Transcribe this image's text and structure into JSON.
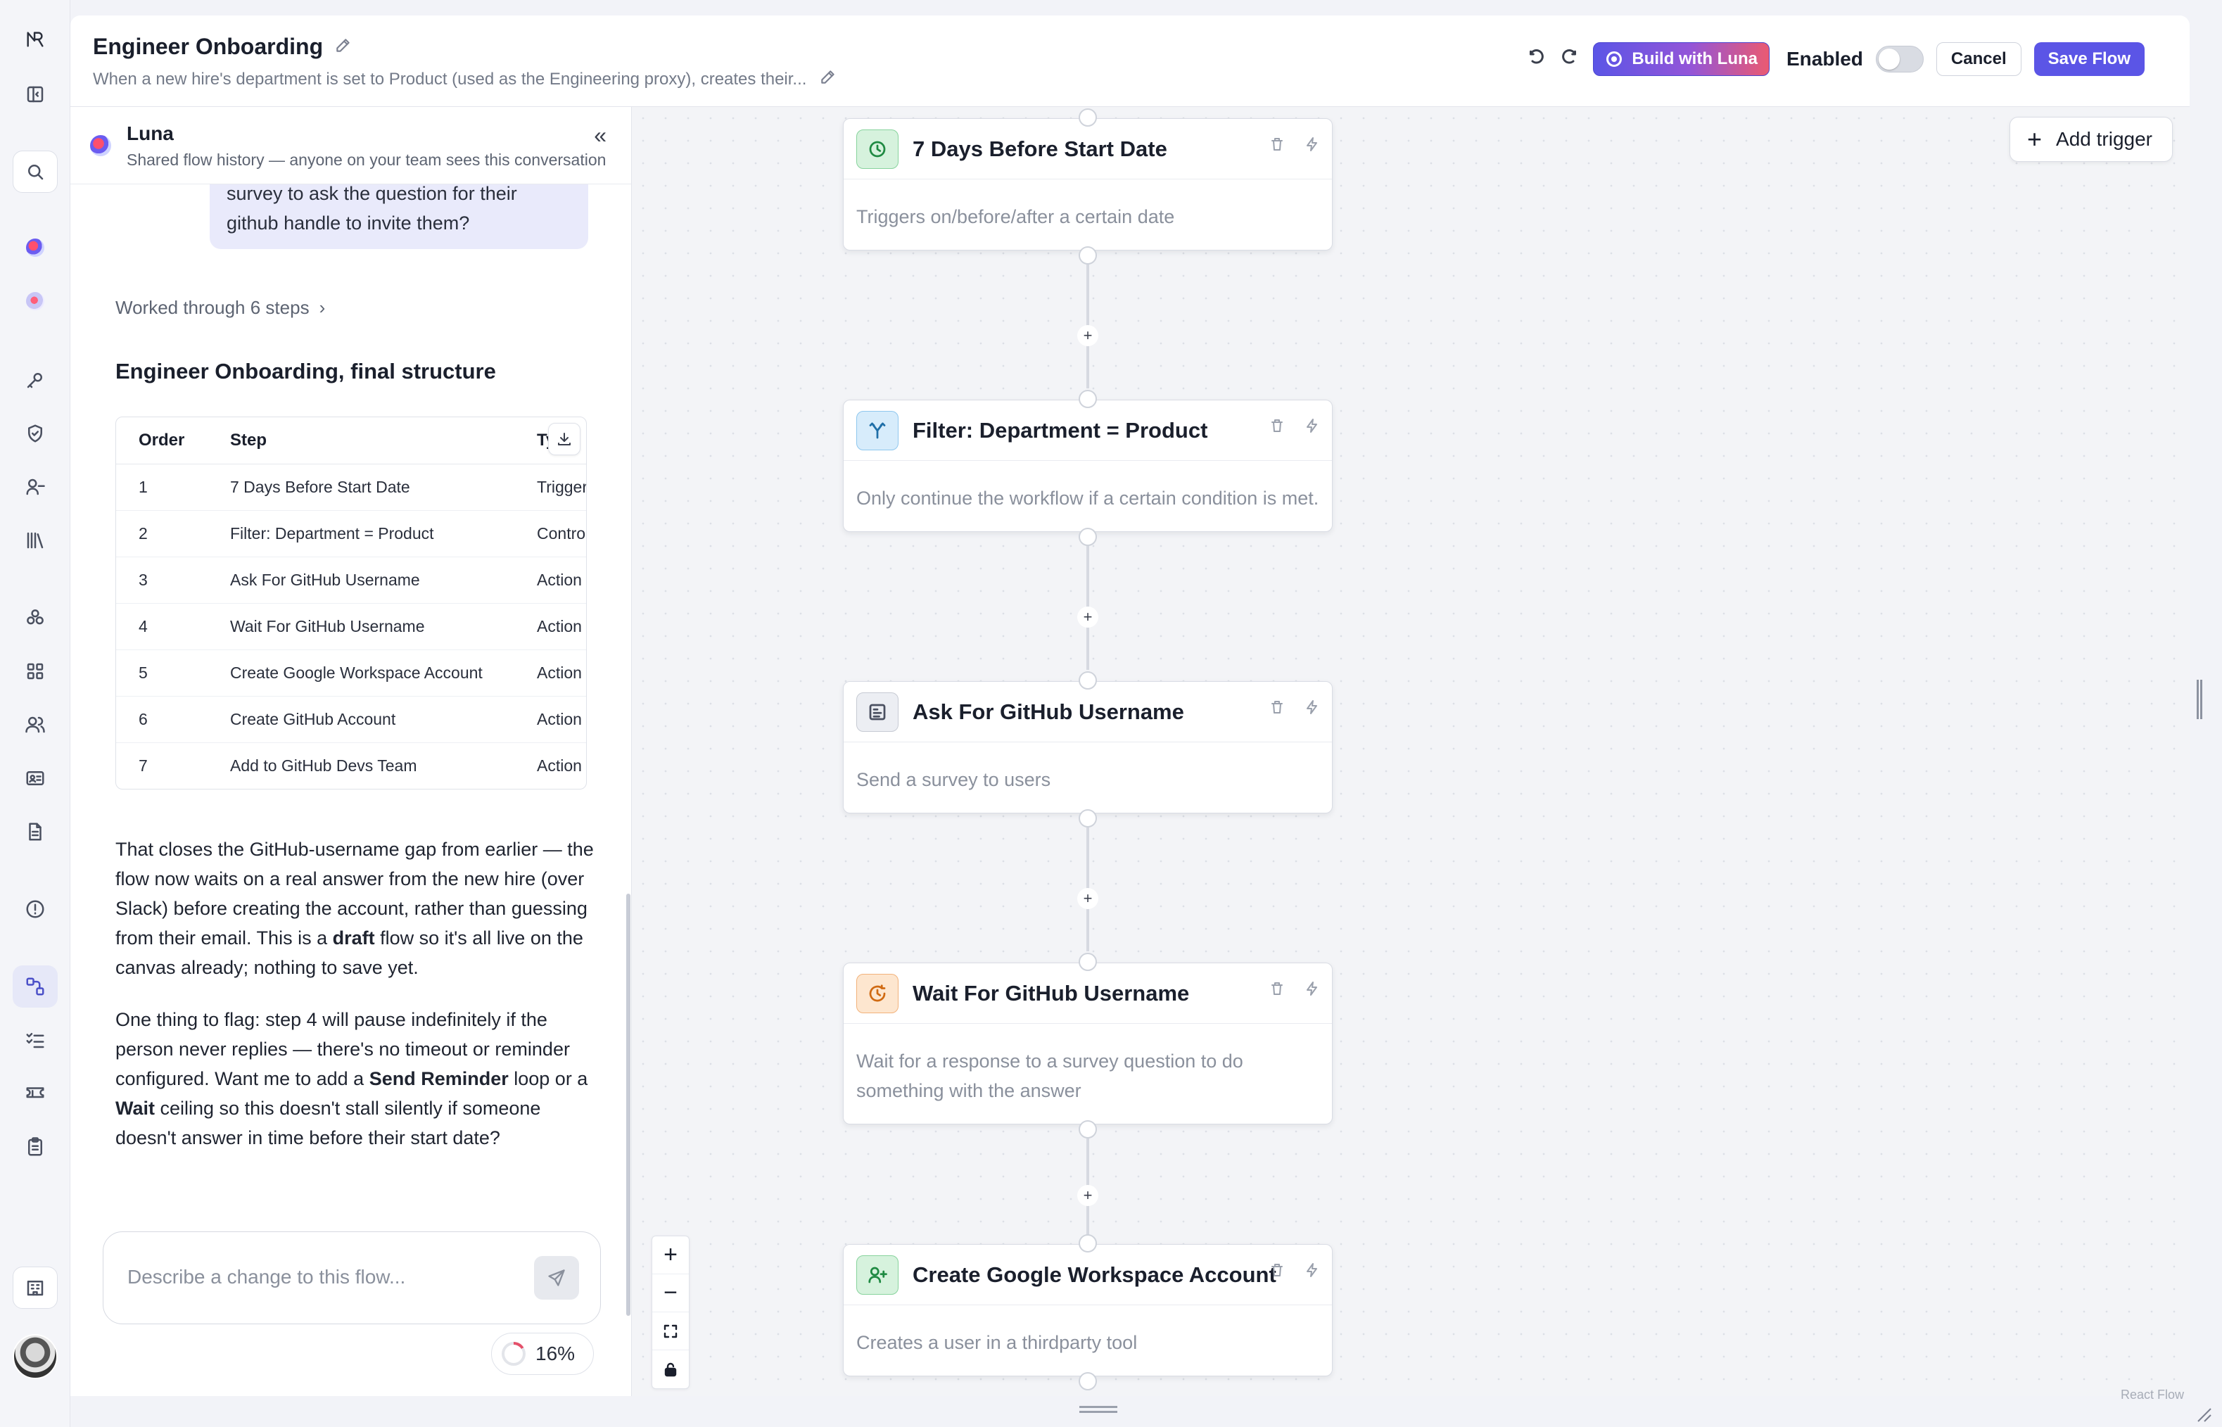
{
  "header": {
    "title": "Engineer Onboarding",
    "subtitle": "When a new hire's department is set to Product (used as the Engineering proxy), creates their...",
    "build_with_luna": "Build with Luna",
    "enabled_label": "Enabled",
    "enabled": false,
    "cancel": "Cancel",
    "save_flow": "Save Flow"
  },
  "sidebar": {
    "icons": [
      "logo-icon",
      "panel-toggle-icon",
      "search-icon",
      "luna-orb-icon",
      "luna-orb-light-icon",
      "key-icon",
      "shield-icon",
      "user-minus-icon",
      "library-icon",
      "integrations-icon",
      "apps-grid-icon",
      "users-icon",
      "id-card-icon",
      "document-icon",
      "alert-icon",
      "workflows-icon",
      "checklist-icon",
      "ticket-icon",
      "clipboard-icon",
      "building-icon"
    ]
  },
  "luna": {
    "name": "Luna",
    "description": "Shared flow history — anyone on your team sees this conversation",
    "user_message_lines": [
      "survey to ask the question for their",
      "github handle to invite them?"
    ],
    "worked_through": "Worked through 6 steps",
    "structure_title": "Engineer Onboarding, final structure",
    "table": {
      "headers": [
        "Order",
        "Step",
        "Type"
      ],
      "rows": [
        [
          "1",
          "7 Days Before Start Date",
          "Trigger"
        ],
        [
          "2",
          "Filter: Department = Product",
          "Control"
        ],
        [
          "3",
          "Ask For GitHub Username",
          "Action"
        ],
        [
          "4",
          "Wait For GitHub Username",
          "Action"
        ],
        [
          "5",
          "Create Google Workspace Account",
          "Action"
        ],
        [
          "6",
          "Create GitHub Account",
          "Action"
        ],
        [
          "7",
          "Add to GitHub Devs Team",
          "Action"
        ]
      ]
    },
    "para1": {
      "t1": "That closes the GitHub-username gap from earlier — the flow now waits on a real answer from the new hire (over Slack) before creating the account, rather than guessing from their email. This is a ",
      "b1": "draft",
      "t2": " flow so it's all live on the canvas already; nothing to save yet."
    },
    "para2": {
      "t1": "One thing to flag: step 4 will pause indefinitely if the person never replies — there's no timeout or reminder configured. Want me to add a ",
      "b1": "Send Reminder",
      "t2": " loop or a ",
      "b2": "Wait",
      "t3": " ceiling so this doesn't stall silently if someone doesn't answer in time before their start date?"
    },
    "composer_placeholder": "Describe a change to this flow...",
    "usage_percent": "16%",
    "usage_fraction": 0.16
  },
  "canvas": {
    "add_trigger": "Add trigger",
    "nodes": [
      {
        "title": "7 Days Before Start Date",
        "description": "Triggers on/before/after a certain date",
        "icon": "clock-icon",
        "color": "green"
      },
      {
        "title": "Filter: Department = Product",
        "description": "Only continue the workflow if a certain condition is met.",
        "icon": "filter-branch-icon",
        "color": "blue"
      },
      {
        "title": "Ask For GitHub Username",
        "description": "Send a survey to users",
        "icon": "survey-icon",
        "color": "gray"
      },
      {
        "title": "Wait For GitHub Username",
        "description": "Wait for a response to a survey question to do something with the answer",
        "icon": "wait-clock-icon",
        "color": "orange"
      },
      {
        "title": "Create Google Workspace Account",
        "description": "Creates a user in a thirdparty tool",
        "icon": "user-plus-icon",
        "color": "green"
      }
    ],
    "attribution": "React Flow"
  }
}
